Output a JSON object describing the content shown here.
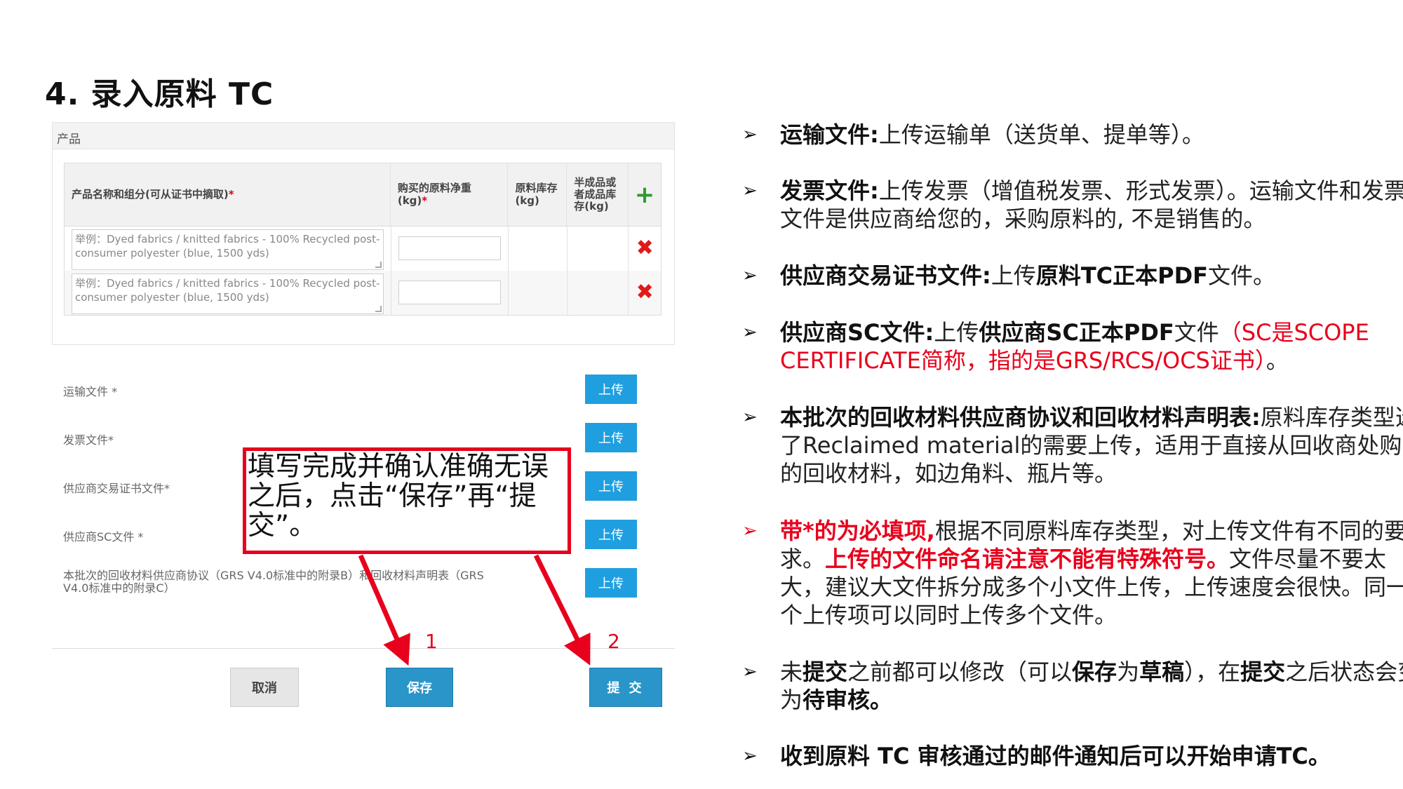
{
  "slide_title": "4. 录入原料 TC",
  "product_panel": {
    "header": "产品",
    "columns": {
      "name": "产品名称和组分(可从证书中摘取)",
      "net_weight": "购买的原料净重(kg)",
      "stock": "原料库存(kg)",
      "semi_stock": "半成品或者成品库存(kg)"
    },
    "required_mark": "*",
    "add_icon": "+",
    "delete_icon": "✖",
    "placeholder": "举例：Dyed fabrics / knitted fabrics - 100% Recycled post-consumer polyester (blue, 1500 yds)"
  },
  "uploads": [
    {
      "label": "运输文件 *",
      "button": "上传"
    },
    {
      "label": "发票文件*",
      "button": "上传"
    },
    {
      "label": "供应商交易证书文件*",
      "button": "上传"
    },
    {
      "label": "供应商SC文件 *",
      "button": "上传"
    },
    {
      "label": "本批次的回收材料供应商协议（GRS V4.0标准中的附录B）和回收材料声明表（GRS V4.0标准中的附录C）",
      "button": "上传"
    }
  ],
  "actions": {
    "cancel": "取消",
    "save": "保存",
    "submit": "提 交"
  },
  "callout": "填写完成并确认准确无误之后，点击“保存”再“提交”。",
  "step_labels": [
    "1",
    "2"
  ],
  "bullet_marker": "➢",
  "bullets": {
    "b1": {
      "bold": "运输文件:",
      "text": "上传运输单（送货单、提单等）。"
    },
    "b2": {
      "bold": "发票文件:",
      "text": "上传发票（增值税发票、形式发票）。运输文件和发票文件是供应商给您的，采购原料的, 不是销售的。"
    },
    "b3": {
      "bold": "供应商交易证书文件:",
      "text1": "上传",
      "bold2": "原料TC正本PDF",
      "text2": "文件。"
    },
    "b4": {
      "bold": "供应商SC文件:",
      "text1": "上传",
      "bold2": "供应商SC正本PDF",
      "text2": "文件",
      "red": "（SC是SCOPE CERTIFICATE简称，指的是GRS/RCS/OCS证书）",
      "end": "。"
    },
    "b5": {
      "bold": "本批次的回收材料供应商协议和回收材料声明表:",
      "text": "原料库存类型选了Reclaimed material的需要上传，适用于直接从回收商处购买的回收材料，如边角料、瓶片等。"
    },
    "b6": {
      "red_bold1": "带*的为必填项,",
      "text1": "根据不同原料库存类型，对上传文件有不同的要求。",
      "red_bold2": "上传的文件命名请注意不能有特殊符号。",
      "text2": "文件尽量不要太大，建议大文件拆分成多个小文件上传，上传速度会很快。同一个上传项可以同时上传多个文件。"
    },
    "b7": {
      "t1": "未",
      "b1": "提交",
      "t2": "之前都可以修改（可以",
      "b2": "保存",
      "t3": "为",
      "b3": "草稿",
      "t4": "），在",
      "b4": "提交",
      "t5": "之后状态会变为",
      "b5": "待审核。"
    },
    "b8": {
      "bold": "收到原料 TC 审核通过的邮件通知后可以开始申请TC。"
    }
  }
}
